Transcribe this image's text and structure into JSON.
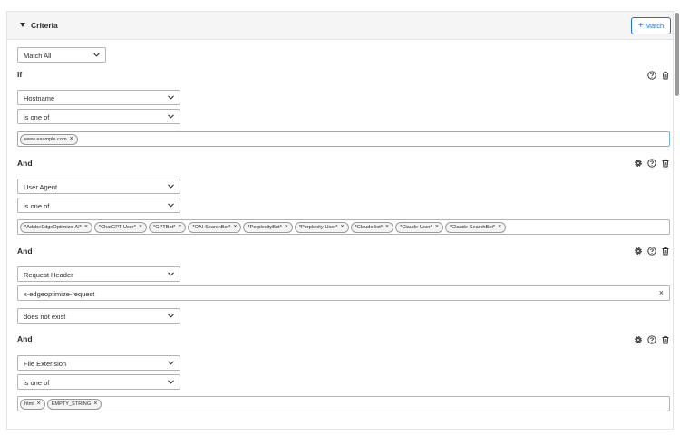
{
  "panel": {
    "title": "Criteria",
    "match_button": "Match",
    "match_plus": "+"
  },
  "match_select": "Match All",
  "if_label": "If",
  "and_label": "And",
  "hostname": {
    "field": "Hostname",
    "operator": "is one of",
    "tags": [
      "www.example.com"
    ]
  },
  "user_agent": {
    "field": "User Agent",
    "operator": "is one of",
    "tags": [
      "*AdobeEdgeOptimize-AI*",
      "*ChatGPT-User*",
      "*GPTBot*",
      "*OAI-SearchBot*",
      "*PerplexityBot*",
      "*Perplexity-User*",
      "*ClaudeBot*",
      "*Claude-User*",
      "*Claude-SearchBot*"
    ]
  },
  "request_header": {
    "field": "Request Header",
    "header_name": "x-edgeoptimize-request",
    "operator": "does not exist"
  },
  "file_extension": {
    "field": "File Extension",
    "operator": "is one of",
    "tags": [
      "html",
      "EMPTY_STRING"
    ]
  },
  "tag_remove_glyph": "×",
  "icons": {
    "help": "help-icon",
    "delete": "trash-icon",
    "settings": "gear-icon",
    "dropdown": "chevron-down-icon",
    "collapse": "caret-down-icon"
  },
  "colors": {
    "accent": "#1473e6",
    "focus_border": "#75b7d9",
    "header_bg": "#f5f5f5"
  }
}
